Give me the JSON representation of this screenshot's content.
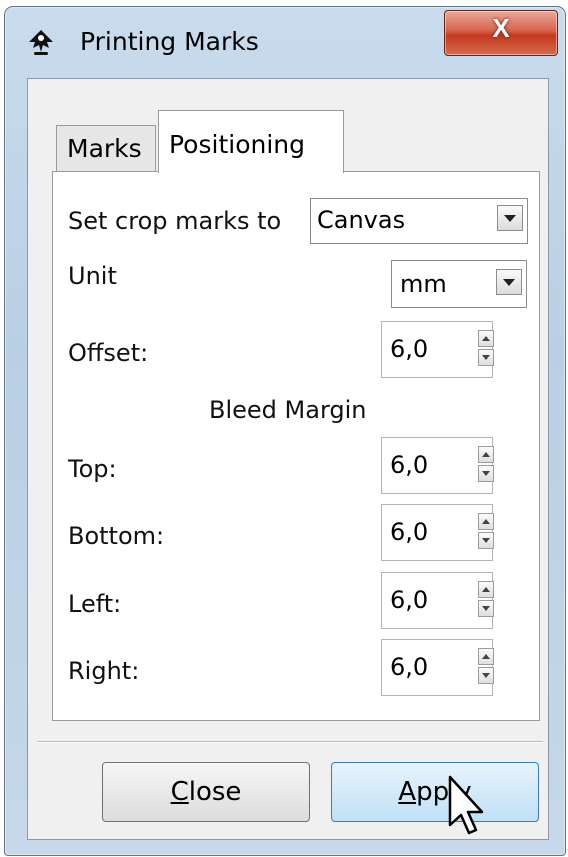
{
  "window": {
    "title": "Printing Marks",
    "close_glyph": "X"
  },
  "tabs": [
    {
      "label": "Marks",
      "active": false
    },
    {
      "label": "Positioning",
      "active": true
    }
  ],
  "positioning": {
    "crop_marks_label": "Set crop marks to",
    "crop_marks_value": "Canvas",
    "unit_label": "Unit",
    "unit_value": "mm",
    "offset_label": "Offset:",
    "offset_value": "6,0",
    "bleed_heading": "Bleed Margin",
    "top_label": "Top:",
    "top_value": "6,0",
    "bottom_label": "Bottom:",
    "bottom_value": "6,0",
    "left_label": "Left:",
    "left_value": "6,0",
    "right_label": "Right:",
    "right_value": "6,0"
  },
  "buttons": {
    "close_mnemonic": "C",
    "close_rest": "lose",
    "apply_mnemonic": "A",
    "apply_rest": "pply"
  },
  "icons": {
    "app": "inkscape-icon",
    "close": "close-icon",
    "cursor": "mouse-pointer-icon"
  },
  "colors": {
    "close_button": "#c4391d",
    "default_button": "#bfe0f6"
  }
}
